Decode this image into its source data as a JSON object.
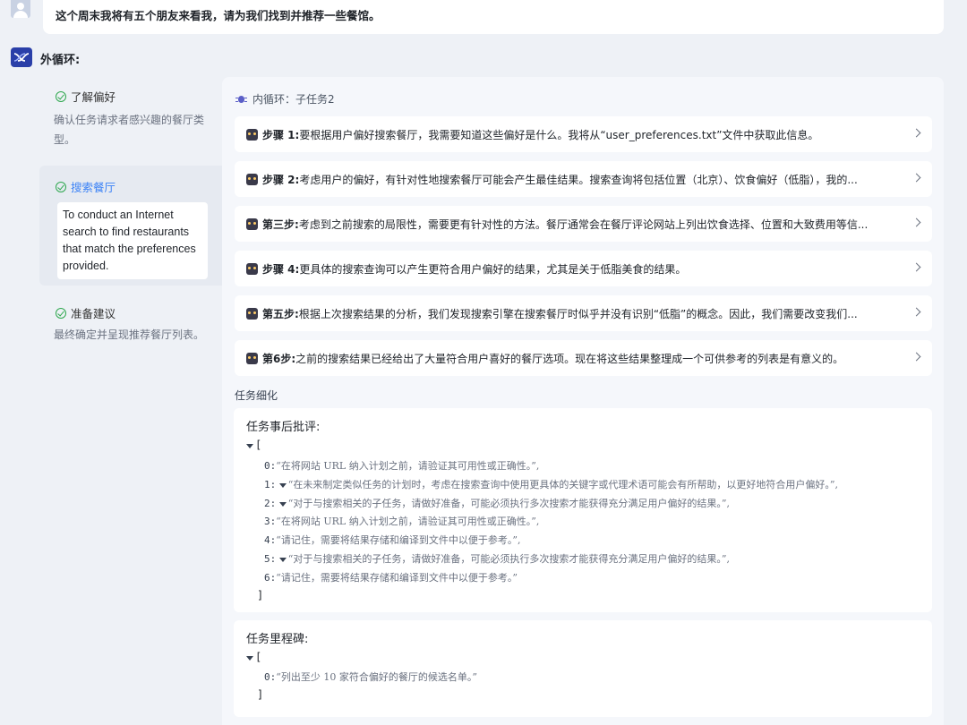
{
  "user_message": "这个周末我将有五个朋友来看我，请为我们找到并推荐一些餐馆。",
  "outer_loop": {
    "title": "外循环:"
  },
  "tasks": [
    {
      "title": "了解偏好",
      "desc": "确认任务请求者感兴趣的餐厅类型。"
    },
    {
      "title": "搜索餐厅",
      "card": "To conduct an Internet search to find restaurants that match the preferences provided."
    },
    {
      "title": "准备建议",
      "desc": "最终确定并呈现推荐餐厅列表。"
    }
  ],
  "inner_loop": {
    "title": "内循环：子任务2"
  },
  "steps": [
    {
      "label": "步骤 1:",
      "text": "要根据用户偏好搜索餐厅，我需要知道这些偏好是什么。我将从“user_preferences.txt”文件中获取此信息。"
    },
    {
      "label": "步骤 2:",
      "text": "考虑用户的偏好，有针对性地搜索餐厅可能会产生最佳结果。搜索查询将包括位置（北京）、饮食偏好（低脂），我的..."
    },
    {
      "label": "第三步:",
      "text": "考虑到之前搜索的局限性，需要更有针对性的方法。餐厅通常会在餐厅评论网站上列出饮食选择、位置和大致费用等信..."
    },
    {
      "label": "步骤 4:",
      "text": "更具体的搜索查询可以产生更符合用户偏好的结果，尤其是关于低脂美食的结果。"
    },
    {
      "label": "第五步:",
      "text": "根据上次搜索结果的分析，我们发现搜索引擎在搜索餐厅时似乎并没有识别“低脂”的概念。因此，我们需要改变我们..."
    },
    {
      "label": "第6步:",
      "text": "之前的搜索结果已经给出了大量符合用户喜好的餐厅选项。现在将这些结果整理成一个可供参考的列表是有意义的。"
    }
  ],
  "detail": {
    "title": "任务细化",
    "critique": {
      "title": "任务事后批评:",
      "open": "[",
      "close": "]",
      "items": [
        {
          "idx": "0:",
          "text": "“在将网站 URL 纳入计划之前，请验证其可用性或正确性。”,",
          "toggle": false
        },
        {
          "idx": "1:",
          "text": "“在未来制定类似任务的计划时，考虑在搜索查询中使用更具体的关键字或代理术语可能会有所帮助，以更好地符合用户偏好。”,",
          "toggle": true
        },
        {
          "idx": "2:",
          "text": "“对于与搜索相关的子任务，请做好准备，可能必须执行多次搜索才能获得充分满足用户偏好的结果。”,",
          "toggle": true
        },
        {
          "idx": "3:",
          "text": "“在将网站 URL 纳入计划之前，请验证其可用性或正确性。”,",
          "toggle": false
        },
        {
          "idx": "4:",
          "text": "“请记住，需要将结果存储和编译到文件中以便于参考。”,",
          "toggle": false
        },
        {
          "idx": "5:",
          "text": "“对于与搜索相关的子任务，请做好准备，可能必须执行多次搜索才能获得充分满足用户偏好的结果。”,",
          "toggle": true
        },
        {
          "idx": "6:",
          "text": "“请记住，需要将结果存储和编译到文件中以便于参考。”",
          "toggle": false
        }
      ]
    },
    "milestones": {
      "title": "任务里程碑:",
      "open": "[",
      "close": "]",
      "items": [
        {
          "idx": "0:",
          "text": "“列出至少 10 家符合偏好的餐厅的候选名单。”"
        }
      ]
    }
  }
}
